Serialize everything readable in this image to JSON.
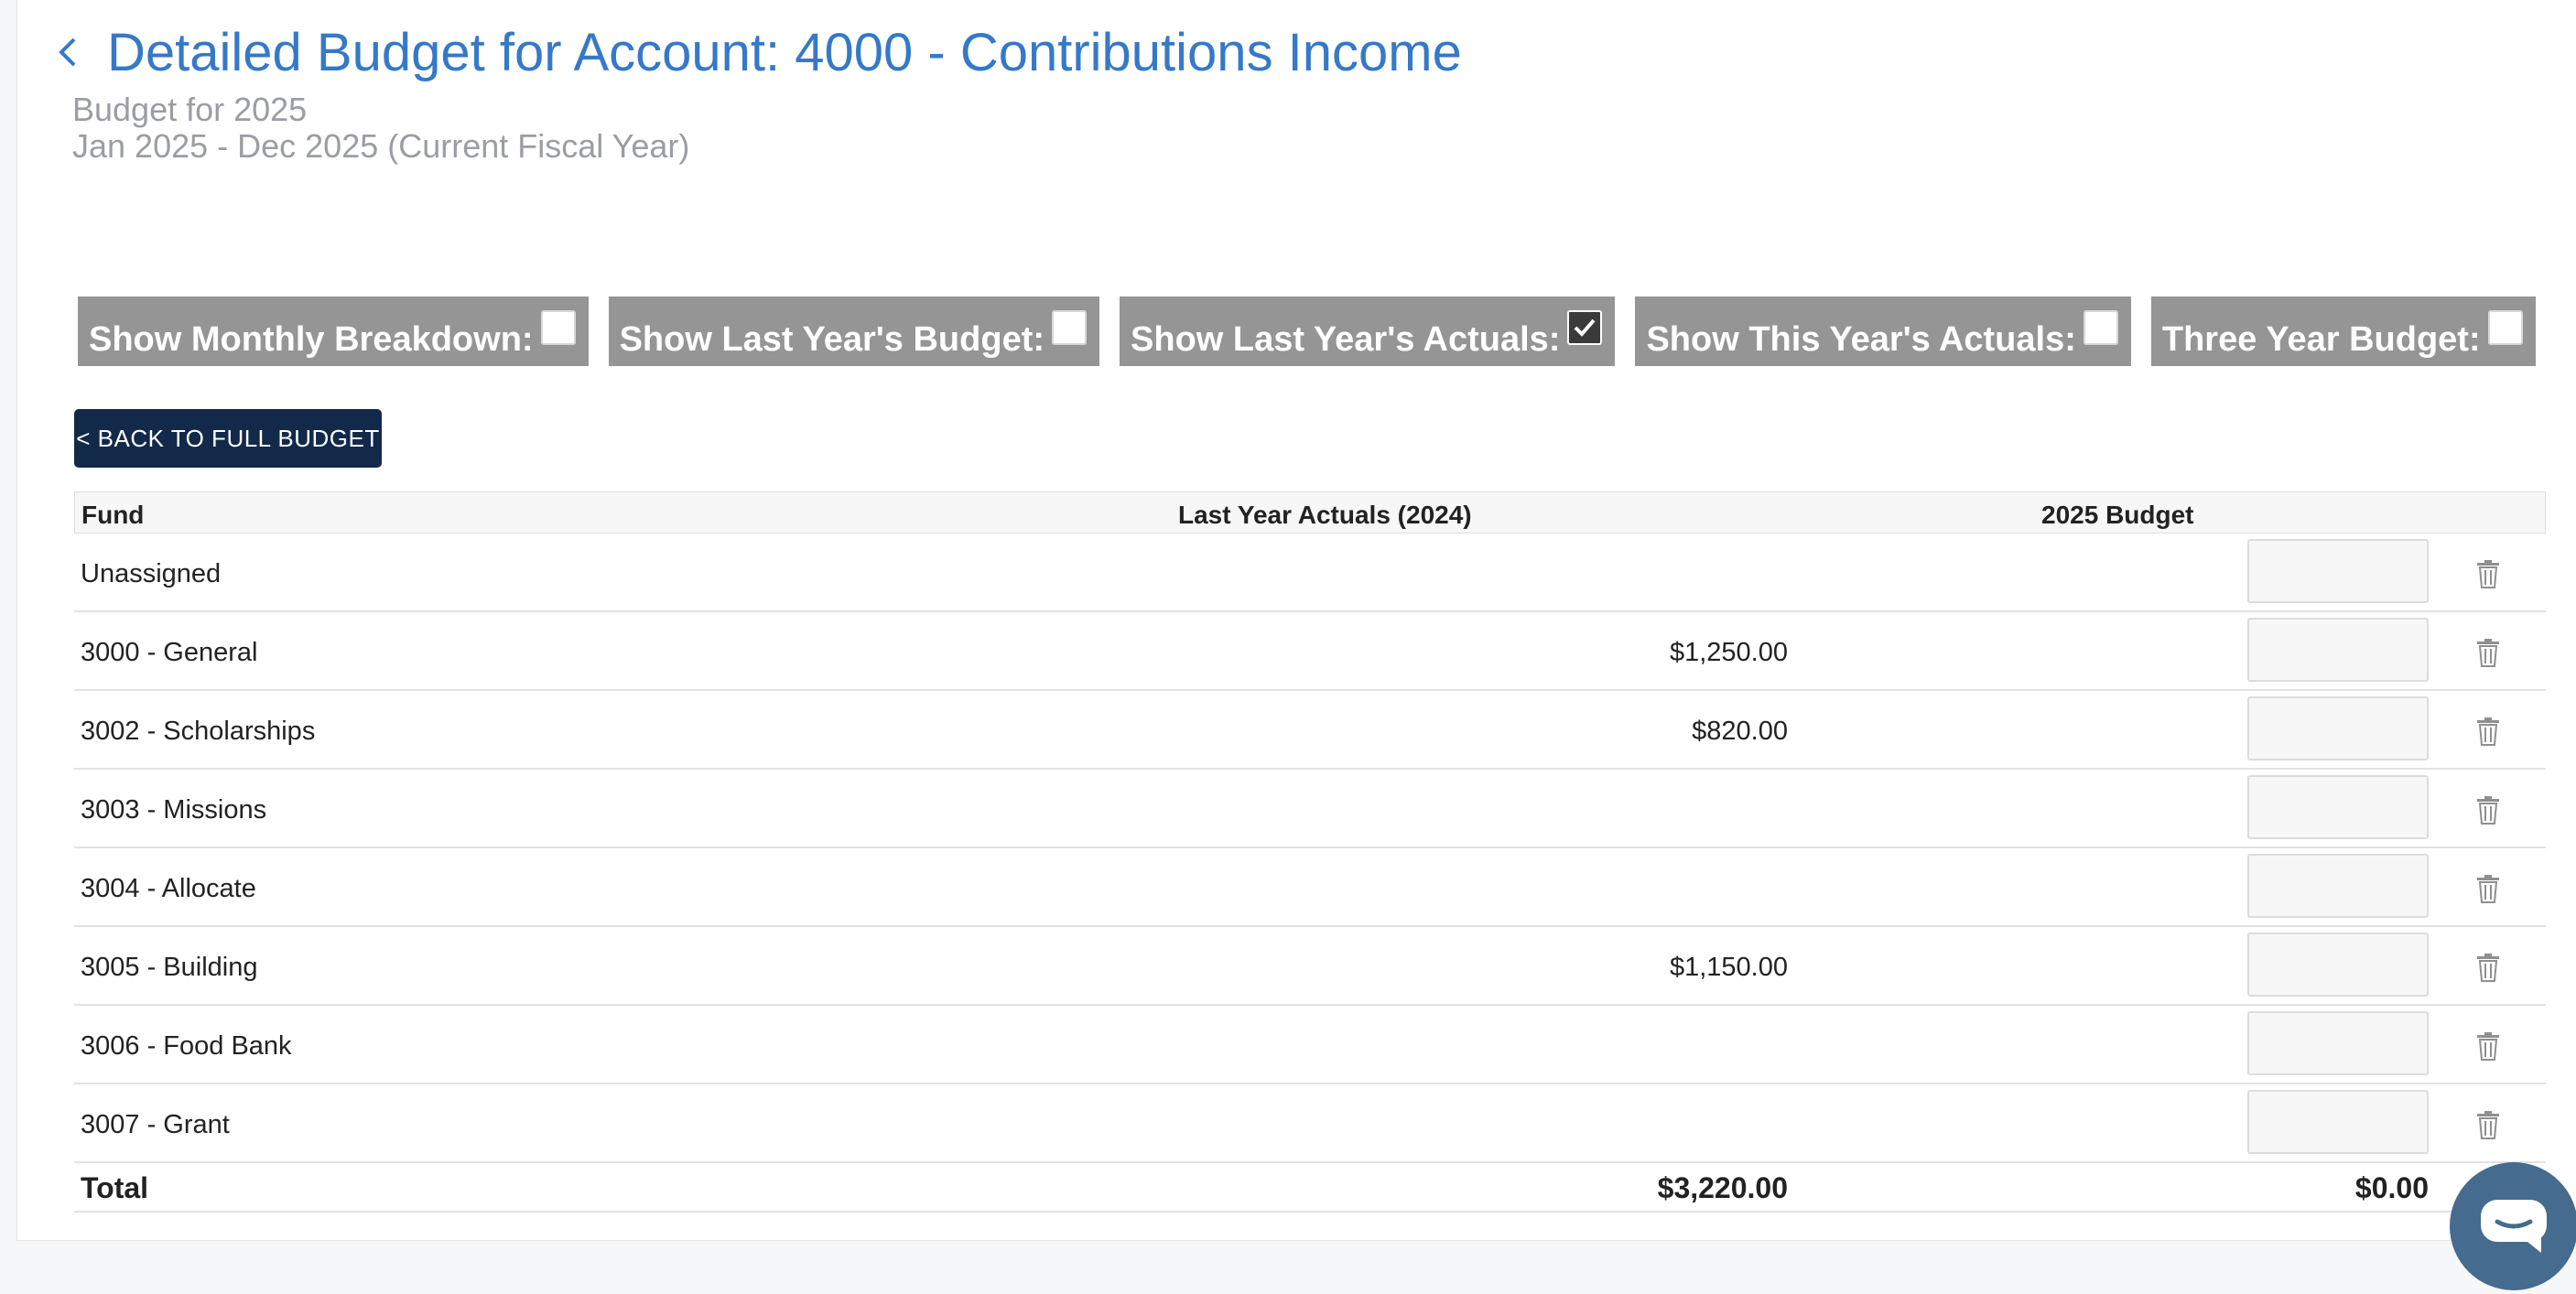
{
  "header": {
    "title": "Detailed Budget for Account: 4000 - Contributions Income",
    "subtitle_budget": "Budget for 2025",
    "subtitle_period": "Jan 2025 - Dec 2025 (Current Fiscal Year)"
  },
  "options": [
    {
      "label": "Show Monthly Breakdown:",
      "checked": false
    },
    {
      "label": "Show Last Year's Budget:",
      "checked": false
    },
    {
      "label": "Show Last Year's Actuals:",
      "checked": true
    },
    {
      "label": "Show This Year's Actuals:",
      "checked": false
    },
    {
      "label": "Three Year Budget:",
      "checked": false
    }
  ],
  "back_button_label": "< BACK TO FULL BUDGET",
  "table": {
    "columns": [
      "Fund",
      "Last Year Actuals (2024)",
      "2025 Budget"
    ],
    "rows": [
      {
        "fund": "Unassigned",
        "last_year_actuals": "",
        "budget": ""
      },
      {
        "fund": "3000 - General",
        "last_year_actuals": "$1,250.00",
        "budget": ""
      },
      {
        "fund": "3002 - Scholarships",
        "last_year_actuals": "$820.00",
        "budget": ""
      },
      {
        "fund": "3003 - Missions",
        "last_year_actuals": "",
        "budget": ""
      },
      {
        "fund": "3004 - Allocate",
        "last_year_actuals": "",
        "budget": ""
      },
      {
        "fund": "3005 - Building",
        "last_year_actuals": "$1,150.00",
        "budget": ""
      },
      {
        "fund": "3006 - Food Bank",
        "last_year_actuals": "",
        "budget": ""
      },
      {
        "fund": "3007 - Grant",
        "last_year_actuals": "",
        "budget": ""
      }
    ],
    "total": {
      "label": "Total",
      "last_year_actuals": "$3,220.00",
      "budget": "$0.00"
    }
  },
  "icons": {
    "back": "chevron-left-icon",
    "delete": "trash-icon",
    "chat": "chat-icon"
  },
  "colors": {
    "title": "#3579c8",
    "button_bg": "#12294a",
    "chip_bg": "#959595",
    "chat_bg": "#456b8e"
  }
}
